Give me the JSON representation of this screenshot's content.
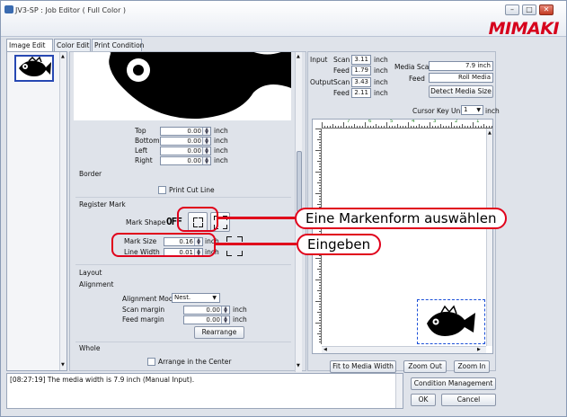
{
  "window": {
    "title": "JV3-SP : Job Editor ( Full Color )",
    "logo": "MIMAKI",
    "controls": {
      "minimize": "–",
      "maximize": "□",
      "close": "✕"
    }
  },
  "tabs": [
    {
      "label": "Image Edit",
      "active": true
    },
    {
      "label": "Color Edit",
      "active": false
    },
    {
      "label": "Print Condition",
      "active": false
    }
  ],
  "margins": {
    "top_label": "Top",
    "top_value": "0.00",
    "bottom_label": "Bottom",
    "bottom_value": "0.00",
    "left_label": "Left",
    "left_value": "0.00",
    "right_label": "Right",
    "right_value": "0.00",
    "unit": "inch"
  },
  "border": {
    "heading": "Border",
    "print_cut_line_label": "Print Cut Line"
  },
  "register_mark": {
    "heading": "Register Mark",
    "mark_shape_label": "Mark Shape",
    "off_label": "OFF",
    "mark_size_label": "Mark Size",
    "mark_size_value": "0.16",
    "line_width_label": "Line Width",
    "line_width_value": "0.01",
    "unit": "inch"
  },
  "layout": {
    "heading": "Layout",
    "alignment_heading": "Alignment",
    "alignment_mode_label": "Alignment Mode",
    "alignment_mode_value": "Nest.",
    "scan_margin_label": "Scan margin",
    "scan_margin_value": "0.00",
    "feed_margin_label": "Feed margin",
    "feed_margin_value": "0.00",
    "unit": "inch",
    "rearrange_label": "Rearrange",
    "whole_heading": "Whole",
    "arrange_center_label": "Arrange in the Center"
  },
  "info": {
    "input_label": "Input",
    "scan_label": "Scan",
    "input_scan_value": "3.11",
    "feed_label": "Feed",
    "input_feed_value": "1.79",
    "output_label": "Output",
    "output_scan_value": "3.43",
    "output_feed_value": "2.11",
    "unit": "inch",
    "media_scan_label": "Media Scan",
    "media_scan_value": "7.9 inch",
    "media_feed_label": "Feed",
    "media_feed_value": "Roll Media",
    "detect_media_size_label": "Detect Media Size",
    "cursor_key_unit_label": "Cursor Key Unit",
    "cursor_key_unit_value": "1",
    "cursor_key_unit_unit": "inch"
  },
  "preview": {
    "ruler_numbers": [
      "7",
      "6",
      "5",
      "4",
      "3",
      "2",
      "1"
    ],
    "fit_label": "Fit to Media Width",
    "zoom_out_label": "Zoom Out",
    "zoom_in_label": "Zoom In"
  },
  "status": {
    "message": "[08:27:19] The media width is 7.9 inch (Manual Input)."
  },
  "bottom_buttons": {
    "condition_management_label": "Condition Management",
    "ok_label": "OK",
    "cancel_label": "Cancel"
  },
  "callouts": {
    "select_mark_shape": "Eine Markenform auswählen",
    "enter": "Eingeben"
  },
  "colors": {
    "accent_red": "#e0001b",
    "logo_red": "#d6001c",
    "panel_bg": "#dfe3ea"
  }
}
